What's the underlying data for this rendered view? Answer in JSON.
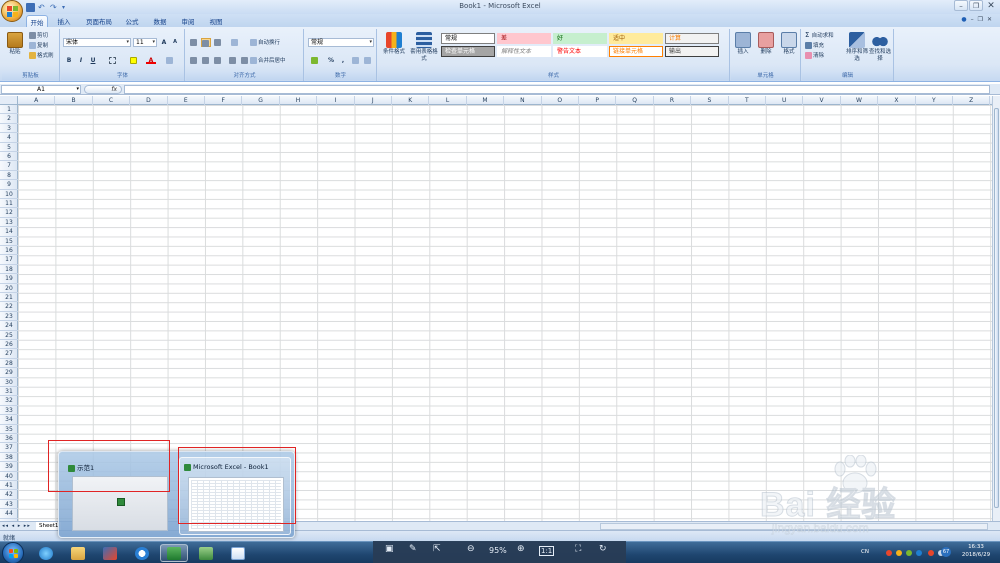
{
  "window": {
    "title": "Book1 - Microsoft Excel"
  },
  "qat_icons": [
    "save-icon",
    "undo-icon",
    "redo-icon",
    "customize-icon"
  ],
  "ribbon": {
    "tabs": [
      "开始",
      "插入",
      "页面布局",
      "公式",
      "数据",
      "审阅",
      "视图"
    ],
    "active_tab": "开始",
    "clipboard": {
      "paste": "粘贴",
      "cut": "剪切",
      "copy": "复制",
      "format_painter": "格式刷",
      "label": "剪贴板"
    },
    "font": {
      "name": "宋体",
      "size": "11",
      "bold": "B",
      "italic": "I",
      "underline": "U",
      "grow": "A",
      "shrink": "A",
      "color": "A",
      "label": "字体"
    },
    "alignment": {
      "wrap": "自动换行",
      "merge": "合并后居中",
      "label": "对齐方式"
    },
    "number": {
      "format": "常规",
      "percent": "%",
      "comma": ",",
      "label": "数字"
    },
    "styles": {
      "conditional": "条件格式",
      "table": "套用表格格式",
      "cells": [
        {
          "text": "常规",
          "bg": "#ffffff",
          "fg": "#000000",
          "border": "#7f7f7f"
        },
        {
          "text": "差",
          "bg": "#ffc7ce",
          "fg": "#9c0006",
          "border": "#ffc7ce"
        },
        {
          "text": "好",
          "bg": "#c6efce",
          "fg": "#006100",
          "border": "#c6efce"
        },
        {
          "text": "适中",
          "bg": "#ffeb9c",
          "fg": "#9c5700",
          "border": "#ffeb9c"
        },
        {
          "text": "计算",
          "bg": "#f2f2f2",
          "fg": "#fa7d00",
          "border": "#7f7f7f"
        },
        {
          "text": "检查单元格",
          "bg": "#a5a5a5",
          "fg": "#ffffff",
          "border": "#3f3f3f"
        },
        {
          "text": "解释性文本",
          "bg": "#ffffff",
          "fg": "#7f7f7f",
          "border": "#ffffff"
        },
        {
          "text": "警告文本",
          "bg": "#ffffff",
          "fg": "#ff0000",
          "border": "#ffffff"
        },
        {
          "text": "链接单元格",
          "bg": "#ffffff",
          "fg": "#fa7d00",
          "border": "#ff8001"
        },
        {
          "text": "输出",
          "bg": "#f2f2f2",
          "fg": "#3f3f3f",
          "border": "#3f3f3f"
        }
      ],
      "label": "样式"
    },
    "cells_group": {
      "insert": "插入",
      "delete": "删除",
      "format": "格式",
      "label": "单元格"
    },
    "editing": {
      "autosum": "自动求和",
      "fill": "填充",
      "clear": "清除",
      "sort": "排序和筛选",
      "find": "查找和选择",
      "label": "编辑"
    }
  },
  "formula_bar": {
    "name_box": "A1",
    "fx": "fx"
  },
  "grid": {
    "columns": [
      "A",
      "B",
      "C",
      "D",
      "E",
      "F",
      "G",
      "H",
      "I",
      "J",
      "K",
      "L",
      "M",
      "N",
      "O",
      "P",
      "Q",
      "R",
      "S",
      "T",
      "U",
      "V",
      "W",
      "X",
      "Y",
      "Z"
    ],
    "rows": [
      "1",
      "2",
      "3",
      "4",
      "5",
      "6",
      "7",
      "8",
      "9",
      "10",
      "11",
      "12",
      "13",
      "14",
      "15",
      "16",
      "17",
      "18",
      "19",
      "20",
      "21",
      "22",
      "23",
      "24",
      "25",
      "26",
      "27",
      "28",
      "29",
      "30",
      "31",
      "32",
      "33",
      "34",
      "35",
      "36",
      "37",
      "38",
      "39",
      "40",
      "41",
      "42",
      "43",
      "44"
    ]
  },
  "sheet_tab": "Sheet1",
  "status": "就绪",
  "preview": {
    "thumb1_title": "示范1",
    "thumb2_title": "Microsoft Excel - Book1"
  },
  "viewer": {
    "zoom": "95%",
    "one_to_one": "1:1"
  },
  "tray": {
    "lang": "CN",
    "badge": "67"
  },
  "clock": {
    "time": "16:33",
    "date": "2018/6/29"
  },
  "watermark": {
    "text": "Bai 经验",
    "url": "jingyan.baidu.com"
  }
}
